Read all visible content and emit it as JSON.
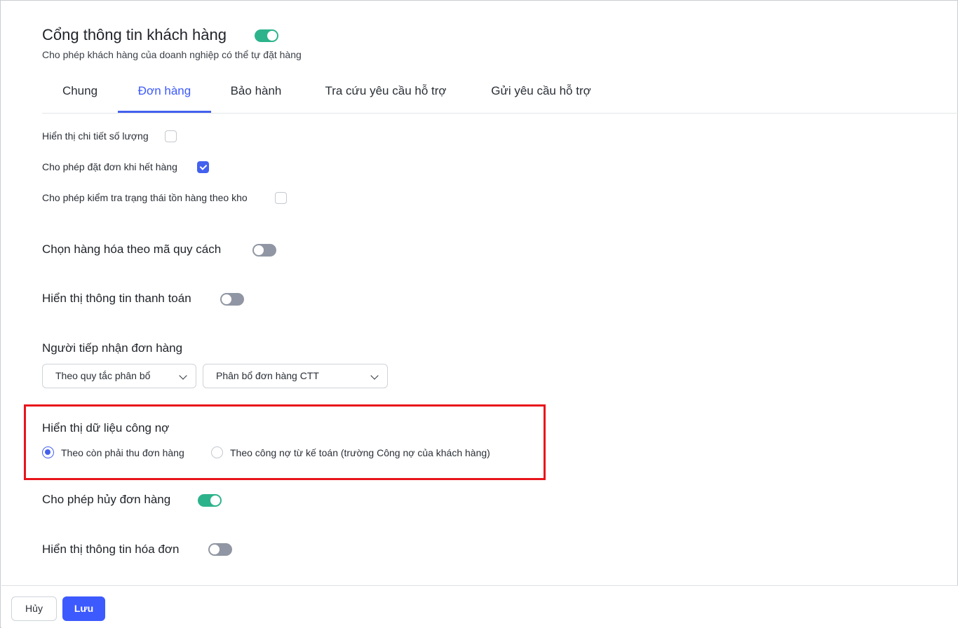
{
  "header": {
    "title": "Cổng thông tin khách hàng",
    "subtitle": "Cho phép khách hàng của doanh nghiệp có thể tự đặt hàng",
    "enabled": true
  },
  "tabs": [
    {
      "label": "Chung",
      "active": false
    },
    {
      "label": "Đơn hàng",
      "active": true
    },
    {
      "label": "Bảo hành",
      "active": false
    },
    {
      "label": "Tra cứu yêu cầu hỗ trợ",
      "active": false
    },
    {
      "label": "Gửi yêu cầu hỗ trợ",
      "active": false
    }
  ],
  "checkboxes": [
    {
      "label": "Hiển thị chi tiết số lượng",
      "checked": false
    },
    {
      "label": "Cho phép đặt đơn khi hết hàng",
      "checked": true
    },
    {
      "label": "Cho phép kiểm tra trạng thái tồn hàng theo kho",
      "checked": false
    }
  ],
  "settings": {
    "spec_code": {
      "label": "Chọn hàng hóa theo mã quy cách",
      "enabled": false
    },
    "payment_info": {
      "label": "Hiển thị thông tin thanh toán",
      "enabled": false
    },
    "receiver": {
      "label": "Người tiếp nhận đơn hàng",
      "rule_select": "Theo quy tắc phân bổ",
      "allocation_select": "Phân bổ đơn hàng CTT"
    },
    "debt_data": {
      "label": "Hiển thị dữ liệu công nợ",
      "options": [
        {
          "label": "Theo còn phải thu đơn hàng",
          "selected": true
        },
        {
          "label": "Theo công nợ từ kế toán (trường Công nợ của khách hàng)",
          "selected": false
        }
      ]
    },
    "cancel_order": {
      "label": "Cho phép hủy đơn hàng",
      "enabled": true
    },
    "invoice_info": {
      "label": "Hiển thị thông tin hóa đơn",
      "enabled": false
    }
  },
  "footer": {
    "cancel_label": "Hủy",
    "save_label": "Lưu"
  },
  "colors": {
    "accent": "#4361ee",
    "toggle_on": "#2db38b",
    "toggle_off": "#9096a3",
    "highlight": "#e8141b"
  }
}
